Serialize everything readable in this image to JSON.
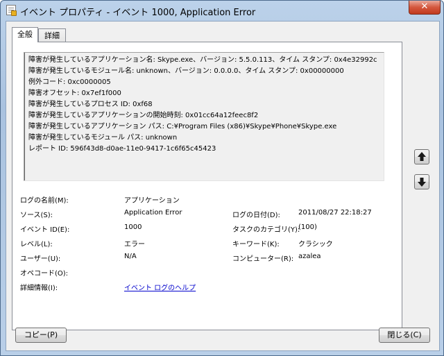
{
  "window": {
    "title": "イベント プロパティ - イベント 1000, Application Error",
    "close_label": "✕"
  },
  "tabs": [
    {
      "label": "全般",
      "active": true
    },
    {
      "label": "詳細",
      "active": false
    }
  ],
  "description_lines": [
    "障害が発生しているアプリケーション名: Skype.exe、バージョン: 5.5.0.113、タイム スタンプ: 0x4e32992c",
    "障害が発生しているモジュール名: unknown、バージョン: 0.0.0.0、タイム スタンプ: 0x00000000",
    "例外コード: 0xc0000005",
    "障害オフセット: 0x7ef1f000",
    "障害が発生しているプロセス ID: 0xf68",
    "障害が発生しているアプリケーションの開始時刻: 0x01cc64a12feec8f2",
    "障害が発生しているアプリケーション パス: C:¥Program Files (x86)¥Skype¥Phone¥Skype.exe",
    "障害が発生しているモジュール パス: unknown",
    "レポート ID: 596f43d8-d0ae-11e0-9417-1c6f65c45423"
  ],
  "fields": {
    "log_name_label": "ログの名前(M):",
    "log_name_value": "アプリケーション",
    "source_label": "ソース(S):",
    "source_value": "Application Error",
    "logged_label": "ログの日付(D):",
    "logged_value": "2011/08/27 22:18:27",
    "event_id_label": "イベント ID(E):",
    "event_id_value": "1000",
    "task_category_label": "タスクのカテゴリ(Y):",
    "task_category_value": "(100)",
    "level_label": "レベル(L):",
    "level_value": "エラー",
    "keywords_label": "キーワード(K):",
    "keywords_value": "クラシック",
    "user_label": "ユーザー(U):",
    "user_value": "N/A",
    "computer_label": "コンピューター(R):",
    "computer_value": "azalea",
    "opcode_label": "オペコード(O):",
    "more_info_label": "詳細情報(I):",
    "more_info_link": "イベント ログのヘルプ"
  },
  "nav": {
    "up_icon": "arrow-up-icon",
    "down_icon": "arrow-down-icon"
  },
  "buttons": {
    "copy": "コピー(P)",
    "close": "閉じる(C)"
  }
}
